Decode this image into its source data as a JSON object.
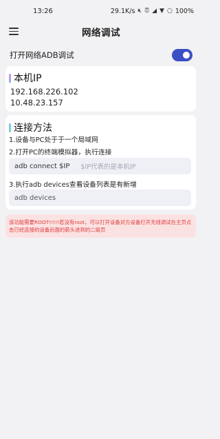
{
  "status_bar": {
    "time": "13:26",
    "net_speed": "29.1K/s",
    "battery": "100%",
    "icons": [
      "mute-icon",
      "alarm-icon",
      "no-sim-icon",
      "wifi-icon",
      "battery-icon"
    ]
  },
  "app_bar": {
    "title": "网络调试",
    "menu_icon": "hamburger-menu-icon"
  },
  "toggle": {
    "label": "打开网络ADB调试",
    "state": "on",
    "color": "#3d4fc4"
  },
  "ip_section": {
    "title": "本机IP",
    "addresses": [
      "192.168.226.102",
      "10.48.23.157"
    ]
  },
  "connect_section": {
    "title": "连接方法",
    "step1": "1.设备与PC处于于一个局域网",
    "step2": "2.打开PC的终端模拟器，执行连接",
    "command1": "adb connect $IP",
    "command1_hint": "$IP代表的是本机IP",
    "step3": "3.执行adb devices查看设备列表是有新增",
    "command2": "adb devices"
  },
  "warning": {
    "text": "该功能需要ROOT!!!!!若没有root，可以打开设备对方设备打开无线调试在主页点击已经连接的设备后面的箭头进到的二级页",
    "color": "#e03b3b",
    "background": "#fbe2e2"
  }
}
